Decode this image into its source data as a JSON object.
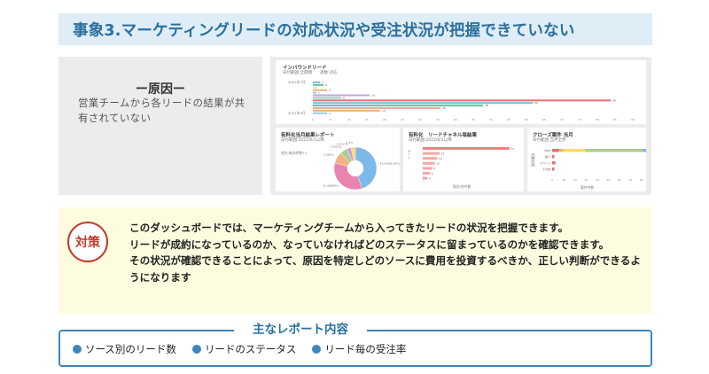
{
  "title": "事象3.マーケティングリードの対応状況や受注状況が把握できていない",
  "cause": {
    "heading": "ー原因ー",
    "text": "営業チームから各リードの結果が共有されていない"
  },
  "dashboard": {
    "inbound": {
      "title": "インバウンドリード",
      "subtitle": "日付範囲:全期間　　週数:対応",
      "row_label_top": "2021年7月",
      "row_label_bottom": "2021年5月",
      "bar_values": [
        2,
        3,
        0,
        4,
        1,
        16,
        8,
        84,
        62,
        48,
        36,
        19,
        4
      ],
      "axis_ticks": [
        "0",
        "5",
        "10",
        "15",
        "20",
        "25",
        "30",
        "35",
        "40",
        "45",
        "50",
        "55",
        "60",
        "65",
        "70",
        "75",
        "80",
        "85",
        "90"
      ],
      "bar_colors": [
        "#7cb9e8",
        "#66c2a5",
        "#f4a6a6",
        "#e6b86e",
        "#9ecae1",
        "#c7a4d9",
        "#8dd3c7",
        "#e87070"
      ]
    },
    "result_report": {
      "title": "有料化当月結果レポート",
      "subtitle": "日付範囲:2022/6/1以降",
      "total_label": "合計:有効件数73",
      "slices": [
        {
          "label": "41.19(96.50%)",
          "value": 41,
          "color": "#7cb9e8"
        },
        {
          "label": "31.36(80%)",
          "value": 31,
          "color": "#e784b0"
        },
        {
          "label": "3.3(6%)",
          "value": 8,
          "color": "#f4b183"
        },
        {
          "label": "1.6%(%)",
          "value": 5,
          "color": "#a8d08d"
        },
        {
          "label": "1.2%(%)",
          "value": 3,
          "color": "#c9a0dc"
        },
        {
          "label": "1.3%",
          "value": 3,
          "color": "#ffd966"
        }
      ]
    },
    "channel": {
      "title": "有料化　リードチャネル毎結果",
      "subtitle": "日付範囲:2022/6/1以降",
      "values": [
        72,
        14,
        12,
        10,
        8,
        6,
        4
      ],
      "axis_label": "既存/合件数",
      "side_label": "ソース",
      "color": "#f4a6a6",
      "highlight": "#f08080"
    },
    "close": {
      "title": "クローズ案件 当月",
      "subtitle": "日付範囲:当月全体",
      "rows": [
        {
          "label": "WEB",
          "values": [
            6,
            4,
            20,
            52,
            4
          ]
        },
        {
          "label": "紹介",
          "values": [
            2
          ]
        },
        {
          "label": "イベント",
          "values": [
            3
          ]
        },
        {
          "label": "その他",
          "values": [
            2
          ]
        }
      ],
      "colors": [
        "#e87070",
        "#f4b183",
        "#ffd966",
        "#a8d08d",
        "#7cb9e8"
      ],
      "axis_ticks": [
        "0",
        "10",
        "20",
        "30",
        "40",
        "50",
        "60",
        "70",
        "80"
      ],
      "side_label": "案件種別",
      "axis_label": "案件件数"
    }
  },
  "policy": {
    "badge": "対策",
    "lines": [
      "このダッシュボードでは、マーケティングチームから入ってきたリードの状況を把握できます。",
      "リードが成約になっているのか、なっていなければどのステータスに留まっているのかを確認できます。",
      "その状況が確認できることによって、原因を特定しどのソースに費用を投資するべきか、正しい判断ができるようになります"
    ]
  },
  "report": {
    "heading": "主なレポート内容",
    "items": [
      "ソース別のリード数",
      "リードのステータス",
      "リード毎の受注率"
    ]
  }
}
